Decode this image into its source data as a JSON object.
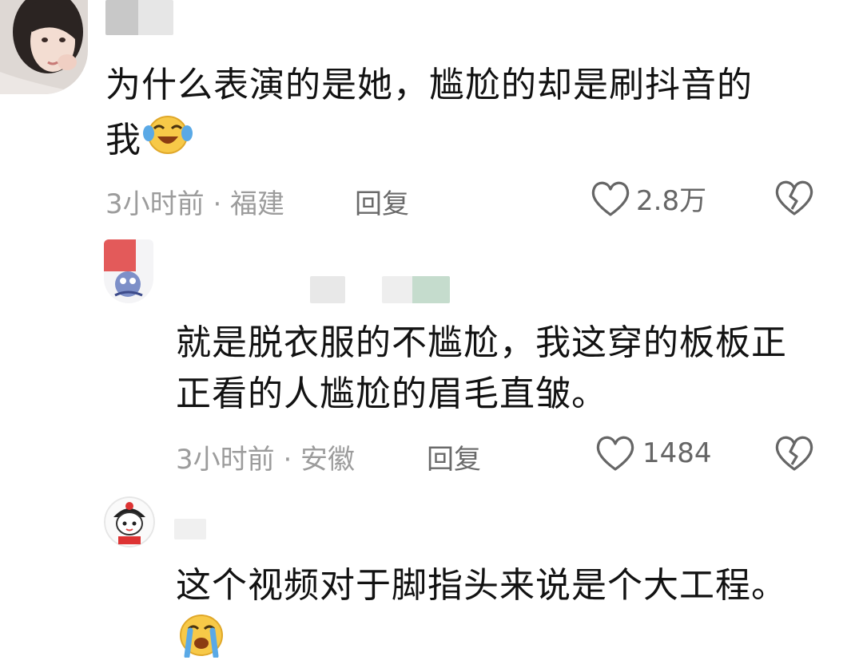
{
  "colors": {
    "text": "#121212",
    "meta": "#9c9c9c",
    "icon": "#666666",
    "emoji_yellow": "#f7c948",
    "tear_blue": "#5aa9e6"
  },
  "comments": [
    {
      "avatar": "avatar-photo-woman",
      "username": "",
      "text_line1": "为什么表演的是她，尴尬的却是刷抖音的",
      "text_line2": "我",
      "emoji": "laugh-cry-emoji",
      "meta": "3小时前 · 福建",
      "reply_label": "回复",
      "like_count": "2.8万",
      "like_icon": "heart-outline-icon",
      "dislike_icon": "broken-heart-icon"
    },
    {
      "avatar": "avatar-cartoon-blue",
      "username": "",
      "text_line1": "就是脱衣服的不尴尬，我这穿的板板正",
      "text_line2": "正看的人尴尬的眉毛直皱。",
      "meta": "3小时前 · 安徽",
      "reply_label": "回复",
      "like_count": "1484",
      "like_icon": "heart-outline-icon",
      "dislike_icon": "broken-heart-icon"
    },
    {
      "avatar": "avatar-cartoon-girl",
      "username": "",
      "text_line1": "这个视频对于脚指头来说是个大工程。",
      "emoji": "crying-emoji"
    }
  ]
}
